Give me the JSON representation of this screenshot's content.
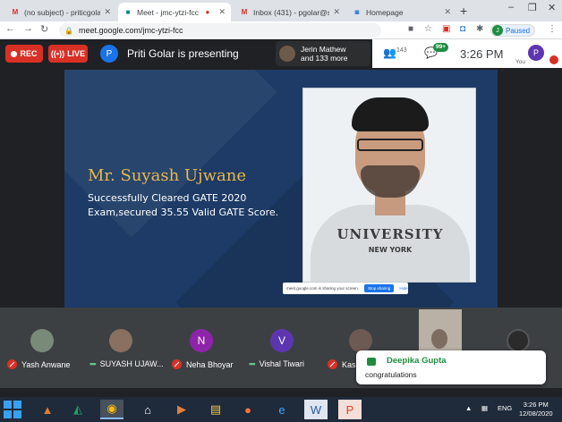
{
  "browser": {
    "tabs": [
      {
        "label": "(no subject) - priticgolar@",
        "favicon": "gmail-icon",
        "active": false
      },
      {
        "label": "Meet - jmc-ytzi-fcc",
        "favicon": "meet-icon",
        "active": true
      },
      {
        "label": "Inbox (431) - pgolar@stvin",
        "favicon": "gmail-icon",
        "active": false
      },
      {
        "label": "Homepage",
        "favicon": "page-icon",
        "active": false
      }
    ],
    "url": "meet.google.com/jmc-ytzi-fcc",
    "profile_initial": "J",
    "profile_status": "Paused",
    "colors": {
      "accent": "#1a73e8",
      "rec": "#d93025",
      "green": "#1e8e3e"
    }
  },
  "meet": {
    "rec_label": "REC",
    "live_label": "LIVE",
    "presenter_initial": "P",
    "presenter_text": "Priti Golar is presenting",
    "joiner_line1": "Jerin Mathew",
    "joiner_line2": "and 133 more",
    "people_count": "143",
    "chat_badge": "99+",
    "time": "3:26 PM",
    "you_initial": "P",
    "you_label": "You"
  },
  "slide": {
    "name": "Mr. Suyash Ujwane",
    "description": "Successfully Cleared GATE 2020 Exam,secured 35.55 Valid GATE Score.",
    "shirt_text": "UNIVERSITY",
    "shirt_text2": "NEW YORK",
    "share_notice": "meet.google.com is sharing your screen.",
    "stop_sharing": "Stop sharing",
    "hide": "Hide"
  },
  "participants": [
    {
      "name": "Yash Anwane",
      "initial": "",
      "muted": true,
      "color": "#7a8a78"
    },
    {
      "name": "SUYASH UJAW...",
      "initial": "",
      "muted": false,
      "color": "#8a7060"
    },
    {
      "name": "Neha Bhoyar",
      "initial": "N",
      "muted": true,
      "color": "#8e24aa"
    },
    {
      "name": "Vishal Tiwari",
      "initial": "V",
      "muted": false,
      "color": "#5e35b1"
    },
    {
      "name": "Kas",
      "initial": "",
      "muted": true,
      "color": "#6d5a52"
    }
  ],
  "toast": {
    "sender": "Deepika Gupta",
    "message": "congratulations"
  },
  "taskbar": {
    "language": "ENG",
    "clock_time": "3:26 PM",
    "clock_date": "12/08/2020"
  }
}
